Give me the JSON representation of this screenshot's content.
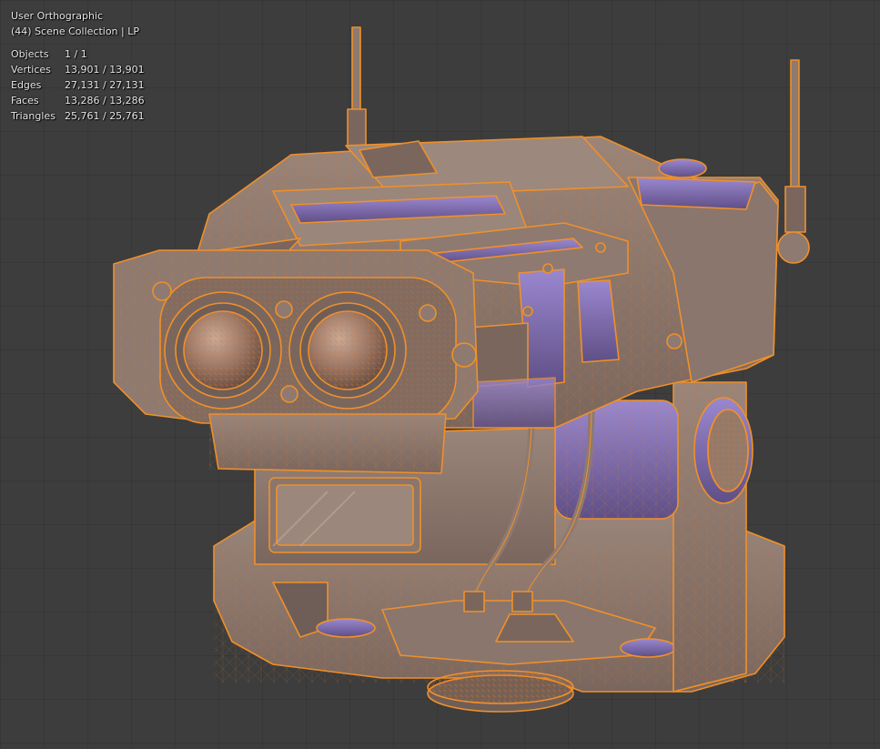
{
  "viewport": {
    "view_name": "User Orthographic",
    "collection": "(44) Scene Collection | LP",
    "stats": [
      {
        "label": "Objects",
        "value": "1 / 1"
      },
      {
        "label": "Vertices",
        "value": "13,901 / 13,901"
      },
      {
        "label": "Edges",
        "value": "27,131 / 27,131"
      },
      {
        "label": "Faces",
        "value": "13,286 / 13,286"
      },
      {
        "label": "Triangles",
        "value": "25,761 / 25,761"
      }
    ]
  },
  "colors": {
    "background": "#3d3d3d",
    "mesh_body": "#8e7a70",
    "mesh_shadow": "#6e5e57",
    "accent_purple": "#8a78b8",
    "selection_outline": "#f0902a",
    "wire": "#d9772a"
  },
  "object": {
    "semantic": "robot-camera-head-model",
    "selected": true
  }
}
